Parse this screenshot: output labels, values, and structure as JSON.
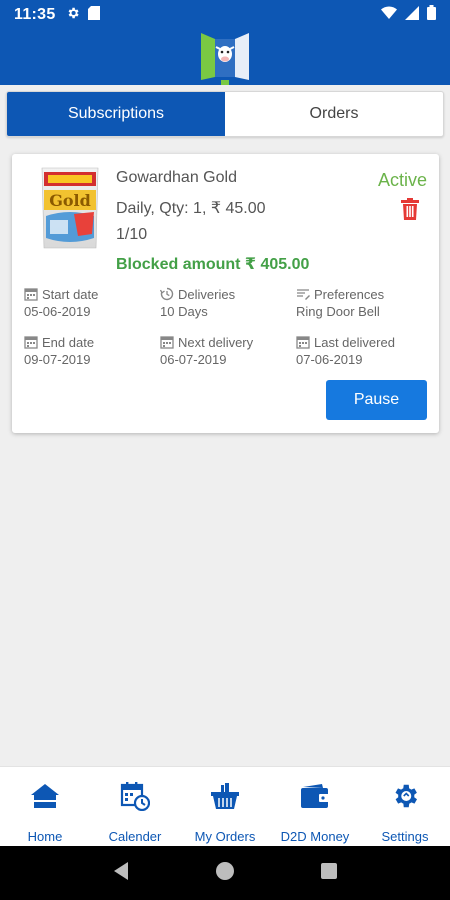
{
  "status_bar": {
    "time": "11:35",
    "left_icons": [
      "gear-icon",
      "sd-card-icon"
    ],
    "right_icons": [
      "wifi-icon",
      "signal-icon",
      "battery-icon"
    ]
  },
  "app_bar": {
    "logo": "d2d-logo"
  },
  "tabs": [
    {
      "label": "Subscriptions",
      "active": true
    },
    {
      "label": "Orders",
      "active": false
    }
  ],
  "subscription": {
    "product_name": "Gowardhan Gold",
    "frequency_qty_price": "Daily, Qty: 1, ₹ 45.00",
    "progress": "1/10",
    "blocked_amount": "Blocked amount ₹ 405.00",
    "status": "Active",
    "details": {
      "start_date": {
        "label": "Start date",
        "value": "05-06-2019",
        "icon": "calendar-icon"
      },
      "deliveries": {
        "label": "Deliveries",
        "value": "10 Days",
        "icon": "history-icon"
      },
      "preferences": {
        "label": "Preferences",
        "value": "Ring Door Bell",
        "icon": "notes-icon"
      },
      "end_date": {
        "label": "End date",
        "value": "09-07-2019",
        "icon": "calendar-icon"
      },
      "next_delivery": {
        "label": "Next delivery",
        "value": "06-07-2019",
        "icon": "calendar-icon"
      },
      "last_delivered": {
        "label": "Last delivered",
        "value": "07-06-2019",
        "icon": "calendar-icon"
      }
    },
    "pause_label": "Pause"
  },
  "bottom_nav": [
    {
      "label": "Home",
      "icon": "home-icon"
    },
    {
      "label": "Calender",
      "icon": "calendar-clock-icon"
    },
    {
      "label": "My Orders",
      "icon": "basket-icon"
    },
    {
      "label": "D2D Money",
      "icon": "wallet-icon"
    },
    {
      "label": "Settings",
      "icon": "settings-icon"
    }
  ],
  "colors": {
    "primary": "#0d57b4",
    "button": "#1679df",
    "active_status": "#6bb34a",
    "blocked_amount": "#43a047",
    "delete": "#e53935"
  }
}
